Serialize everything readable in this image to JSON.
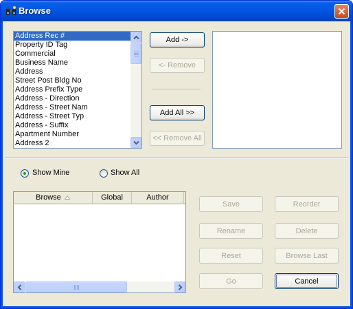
{
  "window": {
    "title": "Browse"
  },
  "field_list": {
    "items": [
      "Address Rec #",
      "Property ID Tag",
      "Commercial",
      "Business Name",
      "Address",
      "Street Post Bldg No",
      "Address Prefix Type",
      "Address - Direction",
      "Address - Street Nam",
      "Address - Street Typ",
      "Address - Suffix",
      "Apartment Number",
      "Address 2"
    ],
    "selected_index": 0
  },
  "transfer": {
    "add": "Add ->",
    "remove": "<- Remove",
    "add_all": "Add All >>",
    "remove_all": "<< Remove All"
  },
  "filter": {
    "show_mine": "Show Mine",
    "show_all": "Show All",
    "selected": "show_mine"
  },
  "browse_grid": {
    "columns": [
      "Browse",
      "Global",
      "Author"
    ],
    "sort_indicator": "ascending-icon",
    "scroll_marker": "III"
  },
  "actions": {
    "save": "Save",
    "reorder": "Reorder",
    "rename": "Rename",
    "delete": "Delete",
    "reset": "Reset",
    "browse_last": "Browse Last",
    "go": "Go",
    "cancel": "Cancel"
  },
  "colors": {
    "title_bar": "#0055e5",
    "selection": "#316ac5",
    "face": "#ece9d8",
    "close": "#c44a20"
  }
}
